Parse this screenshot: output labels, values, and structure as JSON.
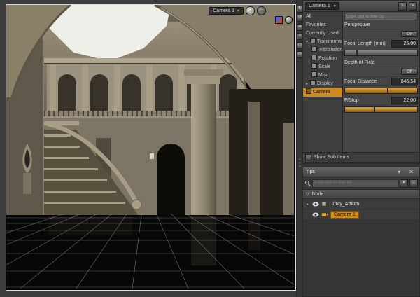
{
  "viewport": {
    "camera_selector": "Camera 1",
    "caret": "▾"
  },
  "view_tools": {
    "icons": [
      "orbit-icon",
      "rotate-icon",
      "pan-icon",
      "dolly-icon",
      "frame-icon",
      "aim-icon"
    ],
    "glyphs": [
      "↻",
      "↺",
      "⊕",
      "⇕",
      "▢",
      "◎"
    ]
  },
  "parameters_panel": {
    "camera_selector": "Camera 1",
    "caret": "▾",
    "filter_placeholder": "Enter text to filter by...",
    "left_nav": [
      "All",
      "Favorites",
      "Currently Used"
    ],
    "tree": [
      {
        "label": "Transforms"
      },
      {
        "label": "Translation"
      },
      {
        "label": "Rotation"
      },
      {
        "label": "Scale"
      },
      {
        "label": "Misc"
      },
      {
        "label": "Display"
      },
      {
        "label": "Camera"
      }
    ],
    "properties": {
      "perspective_label": "Perspective",
      "perspective_state": "On",
      "focal_length_label": "Focal Length (mm)",
      "focal_length_value": "25.00",
      "dof_label": "Depth of Field",
      "dof_state": "Off",
      "focal_distance_label": "Focal Distance",
      "focal_distance_value": "846.54",
      "fstop_label": "F/Stop",
      "fstop_value": "22.00"
    },
    "show_sub_items_label": "Show Sub Items"
  },
  "scene_panel": {
    "tips_label": "Tips",
    "filter_placeholder": "Enter text to filter by...",
    "node_column_header": "Node",
    "nodes": [
      {
        "label": "Tit4y_Atrium",
        "selected": false
      },
      {
        "label": "Camera 1",
        "selected": true
      }
    ]
  },
  "colors": {
    "accent_orange": "#cf8a1d",
    "panel_bg": "#454545",
    "viewport_border": "#dcdcdc"
  }
}
